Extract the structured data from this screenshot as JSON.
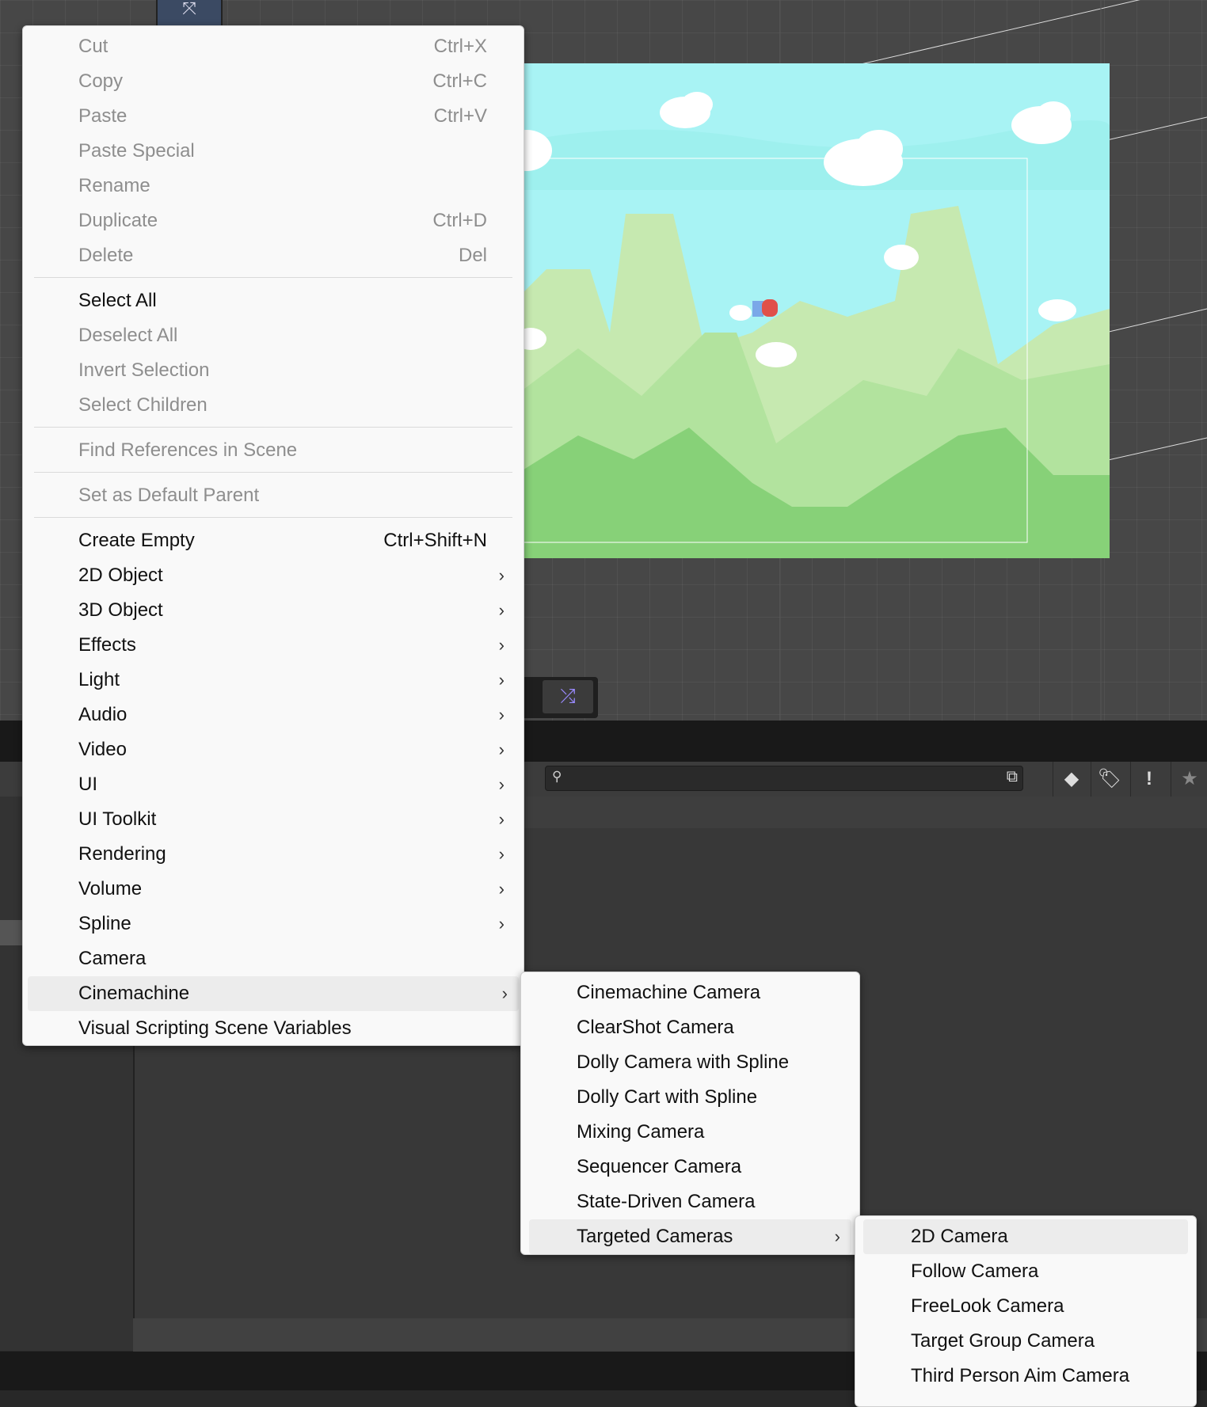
{
  "scene": {
    "toolbar_glyph": "⤧",
    "overlay_icon": "shuffle-icon",
    "overlay_glyph": "⤮",
    "colors": {
      "sky": "#a8f3f4",
      "hills_far": "#c6e9b0",
      "hills_mid": "#b2e39e",
      "ground": "#87d178",
      "grid": "#474747"
    }
  },
  "project_toolbar": {
    "search_placeholder": "",
    "search_icon": "search-icon",
    "expand_icon": "expand-icon",
    "icons": [
      {
        "name": "shapes-filter-icon",
        "glyph": "◆"
      },
      {
        "name": "tag-icon",
        "glyph": "🏷"
      },
      {
        "name": "warning-icon",
        "glyph": "!"
      },
      {
        "name": "star-icon",
        "glyph": "★"
      }
    ]
  },
  "context_menu": {
    "items": [
      {
        "label": "Cut",
        "shortcut": "Ctrl+X",
        "enabled": false
      },
      {
        "label": "Copy",
        "shortcut": "Ctrl+C",
        "enabled": false
      },
      {
        "label": "Paste",
        "shortcut": "Ctrl+V",
        "enabled": false
      },
      {
        "label": "Paste Special",
        "shortcut": "",
        "enabled": false
      },
      {
        "label": "Rename",
        "shortcut": "",
        "enabled": false
      },
      {
        "label": "Duplicate",
        "shortcut": "Ctrl+D",
        "enabled": false
      },
      {
        "label": "Delete",
        "shortcut": "Del",
        "enabled": false
      },
      {
        "label": "Select All",
        "shortcut": "",
        "enabled": true
      },
      {
        "label": "Deselect All",
        "shortcut": "",
        "enabled": false
      },
      {
        "label": "Invert Selection",
        "shortcut": "",
        "enabled": false
      },
      {
        "label": "Select Children",
        "shortcut": "",
        "enabled": false
      },
      {
        "label": "Find References in Scene",
        "shortcut": "",
        "enabled": false
      },
      {
        "label": "Set as Default Parent",
        "shortcut": "",
        "enabled": false
      },
      {
        "label": "Create Empty",
        "shortcut": "Ctrl+Shift+N",
        "enabled": true
      },
      {
        "label": "2D Object",
        "submenu": true,
        "enabled": true
      },
      {
        "label": "3D Object",
        "submenu": true,
        "enabled": true
      },
      {
        "label": "Effects",
        "submenu": true,
        "enabled": true
      },
      {
        "label": "Light",
        "submenu": true,
        "enabled": true
      },
      {
        "label": "Audio",
        "submenu": true,
        "enabled": true
      },
      {
        "label": "Video",
        "submenu": true,
        "enabled": true
      },
      {
        "label": "UI",
        "submenu": true,
        "enabled": true
      },
      {
        "label": "UI Toolkit",
        "submenu": true,
        "enabled": true
      },
      {
        "label": "Rendering",
        "submenu": true,
        "enabled": true
      },
      {
        "label": "Volume",
        "submenu": true,
        "enabled": true
      },
      {
        "label": "Spline",
        "submenu": true,
        "enabled": true
      },
      {
        "label": "Camera",
        "submenu": false,
        "enabled": true
      },
      {
        "label": "Cinemachine",
        "submenu": true,
        "enabled": true,
        "highlighted": true
      },
      {
        "label": "Visual Scripting Scene Variables",
        "submenu": false,
        "enabled": true
      }
    ]
  },
  "cinemachine_menu": {
    "items": [
      {
        "label": "Cinemachine Camera"
      },
      {
        "label": "ClearShot Camera"
      },
      {
        "label": "Dolly Camera with Spline"
      },
      {
        "label": "Dolly Cart with Spline"
      },
      {
        "label": "Mixing Camera"
      },
      {
        "label": "Sequencer Camera"
      },
      {
        "label": "State-Driven Camera"
      },
      {
        "label": "Targeted Cameras",
        "submenu": true,
        "highlighted": true
      }
    ]
  },
  "targeted_menu": {
    "items": [
      {
        "label": "2D Camera",
        "highlighted": true
      },
      {
        "label": "Follow Camera"
      },
      {
        "label": "FreeLook Camera"
      },
      {
        "label": "Target Group Camera"
      },
      {
        "label": "Third Person Aim Camera"
      }
    ]
  },
  "glyphs": {
    "submenu_arrow": "›"
  }
}
